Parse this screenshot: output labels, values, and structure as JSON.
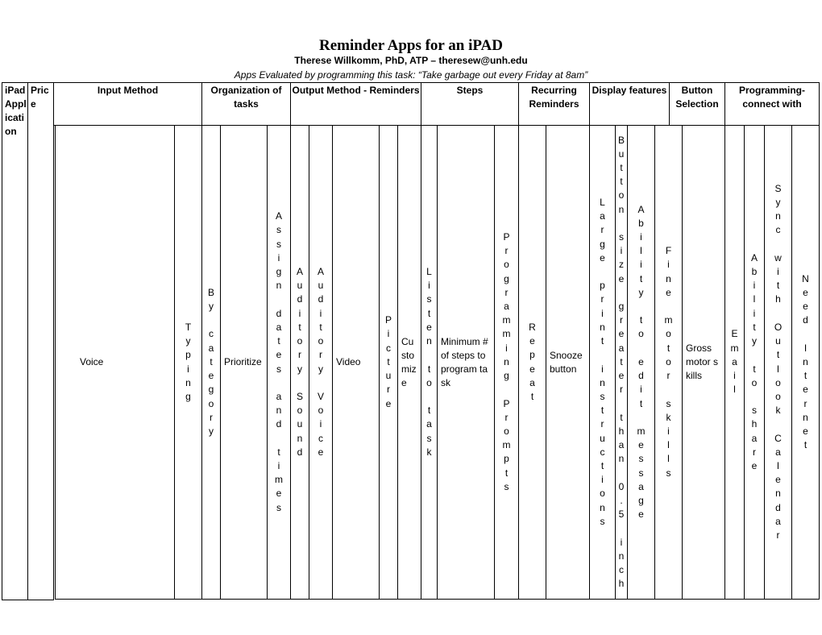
{
  "title": "Reminder Apps for an iPAD",
  "author": "Therese Willkomm, PhD, ATP – theresew@unh.edu",
  "task_note": "Apps Evaluated by programming this task: “Take garbage out every Friday at 8am”",
  "headers": [
    {
      "label": "iPad Application"
    },
    {
      "label": "Price"
    },
    {
      "label": "Input Method"
    },
    {
      "label": "Organization of tasks"
    },
    {
      "label": "Output Method - Reminders"
    },
    {
      "label": "Steps"
    },
    {
      "label": "Recurring Reminders"
    },
    {
      "label": "Display features"
    },
    {
      "label": "Button Selection"
    },
    {
      "label": "Programming- connect with"
    }
  ],
  "subheaders": [
    {
      "label": "Voice",
      "style": "wrap"
    },
    {
      "label": "Typing",
      "style": "stack"
    },
    {
      "label": "By category",
      "style": "stack"
    },
    {
      "label": "Prioritize",
      "style": "wrap"
    },
    {
      "label": "Assign dates and times",
      "style": "stack"
    },
    {
      "label": "Auditory Sound",
      "style": "stack"
    },
    {
      "label": "Auditory Voice",
      "style": "stack"
    },
    {
      "label": "Video",
      "style": "wrap"
    },
    {
      "label": "Picture",
      "style": "stack"
    },
    {
      "label": "Customize",
      "style": "wrap"
    },
    {
      "label": "Listen to task",
      "style": "stack"
    },
    {
      "label": "Minimum # of steps to program task",
      "style": "wrap"
    },
    {
      "label": "Programming Prompts",
      "style": "stack"
    },
    {
      "label": "Repeat",
      "style": "stack"
    },
    {
      "label": "Snooze button",
      "style": "wrap"
    },
    {
      "label": "Large print instructions",
      "style": "stack"
    },
    {
      "label": "Button size greater than 0.5 inch",
      "style": "stack"
    },
    {
      "label": "Ability to edit message",
      "style": "stack"
    },
    {
      "label": "Fine motor skills",
      "style": "stack"
    },
    {
      "label": "Gross motor skills",
      "style": "wrap"
    },
    {
      "label": "Email",
      "style": "stack"
    },
    {
      "label": "Ability to share",
      "style": "stack"
    },
    {
      "label": "Sync with Outlook Calendar",
      "style": "stack"
    },
    {
      "label": "Need Internet",
      "style": "stack"
    }
  ]
}
